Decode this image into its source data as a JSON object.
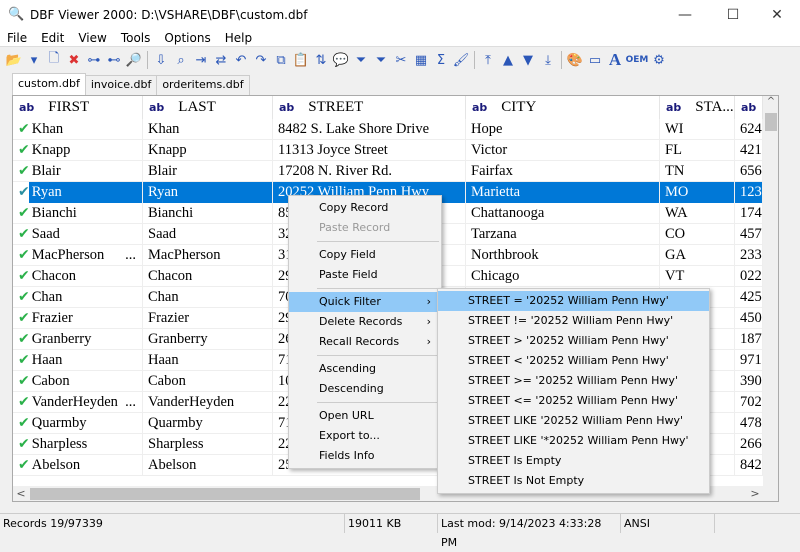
{
  "window": {
    "title": "DBF Viewer 2000: D:\\VSHARE\\DBF\\custom.dbf",
    "minimize": "—",
    "maximize": "☐",
    "close": "✕"
  },
  "menubar": [
    "File",
    "Edit",
    "View",
    "Tools",
    "Options",
    "Help"
  ],
  "toolbar": [
    "open-folder",
    "dropdown",
    "new-record",
    "delete-record",
    "split",
    "merge",
    "find-zoom",
    "sep",
    "goto-record",
    "find",
    "find-next",
    "replace",
    "undo",
    "redo",
    "copy",
    "paste",
    "sort",
    "comment",
    "filter",
    "filter-clear",
    "tools",
    "table",
    "sum",
    "brush",
    "sep",
    "first",
    "prev",
    "next",
    "last",
    "sep",
    "colors",
    "memo",
    "font",
    "oem",
    "settings"
  ],
  "tabs": [
    "custom.dbf",
    "invoice.dbf",
    "orderitems.dbf"
  ],
  "columns": [
    {
      "type": "ab",
      "name": "FIRST"
    },
    {
      "type": "ab",
      "name": "LAST"
    },
    {
      "type": "ab",
      "name": "STREET"
    },
    {
      "type": "ab",
      "name": "CITY"
    },
    {
      "type": "ab",
      "name": "STA..."
    },
    {
      "type": "ab",
      "name": ""
    }
  ],
  "rows": [
    [
      "Khan",
      "Khan",
      "8482 S. Lake Shore Drive",
      "Hope",
      "WI",
      "624"
    ],
    [
      "Knapp",
      "Knapp",
      "11313 Joyce Street",
      "Victor",
      "FL",
      "421"
    ],
    [
      "Blair",
      "Blair",
      "17208 N. River Rd.",
      "Fairfax",
      "TN",
      "656"
    ],
    [
      "Ryan",
      "Ryan",
      "20252 William Penn Hwy",
      "Marietta",
      "MO",
      "123"
    ],
    [
      "Bianchi",
      "Bianchi",
      "85",
      "Chattanooga",
      "WA",
      "174"
    ],
    [
      "Saad",
      "Saad",
      "32",
      "Tarzana",
      "CO",
      "457"
    ],
    [
      "MacPherson",
      "MacPherson",
      "31",
      "Northbrook",
      "GA",
      "233"
    ],
    [
      "Chacon",
      "Chacon",
      "29",
      "Chicago",
      "VT",
      "022"
    ],
    [
      "Chan",
      "Chan",
      "70",
      "",
      "",
      "425"
    ],
    [
      "Frazier",
      "Frazier",
      "29",
      "",
      "",
      "450"
    ],
    [
      "Granberry",
      "Granberry",
      "26",
      "",
      "",
      "187"
    ],
    [
      "Haan",
      "Haan",
      "71",
      "",
      "",
      "971"
    ],
    [
      "Cabon",
      "Cabon",
      "10",
      "",
      "",
      "390"
    ],
    [
      "VanderHeyden",
      "VanderHeyden",
      "22",
      "",
      "",
      "702"
    ],
    [
      "Quarmby",
      "Quarmby",
      "71",
      "",
      "",
      "478"
    ],
    [
      "Sharpless",
      "Sharpless",
      "22",
      "",
      "",
      "266"
    ],
    [
      "Abelson",
      "Abelson",
      "25514 Hoene Place",
      "",
      "",
      "842"
    ]
  ],
  "selected_row": 3,
  "truncated_first": [
    "MacPherson",
    "VanderHeyden"
  ],
  "context_menu": [
    {
      "label": "Copy Record"
    },
    {
      "label": "Paste Record",
      "disabled": true
    },
    {
      "sep": true
    },
    {
      "label": "Copy Field"
    },
    {
      "label": "Paste Field"
    },
    {
      "sep": true
    },
    {
      "label": "Quick Filter",
      "submenu": true,
      "highlighted": true
    },
    {
      "label": "Delete Records",
      "submenu": true
    },
    {
      "label": "Recall Records",
      "submenu": true
    },
    {
      "sep": true
    },
    {
      "label": "Ascending"
    },
    {
      "label": "Descending"
    },
    {
      "sep": true
    },
    {
      "label": "Open URL"
    },
    {
      "label": "Export to..."
    },
    {
      "label": "Fields Info"
    }
  ],
  "quick_filter_menu": [
    "STREET = '20252 William Penn Hwy'",
    "STREET != '20252 William Penn Hwy'",
    "STREET > '20252 William Penn Hwy'",
    "STREET < '20252 William Penn Hwy'",
    "STREET >= '20252 William Penn Hwy'",
    "STREET <= '20252 William Penn Hwy'",
    "STREET LIKE '20252 William Penn Hwy'",
    "STREET LIKE '*20252 William Penn Hwy'",
    "STREET Is Empty",
    "STREET Is Not Empty"
  ],
  "status": {
    "records": "Records 19/97339",
    "size": "19011 KB",
    "modified": "Last mod: 9/14/2023 4:33:28 PM",
    "encoding": "ANSI"
  },
  "colors": {
    "selection": "#0078d7",
    "menu_highlight": "#91c9f7",
    "check": "#2bb14a"
  }
}
